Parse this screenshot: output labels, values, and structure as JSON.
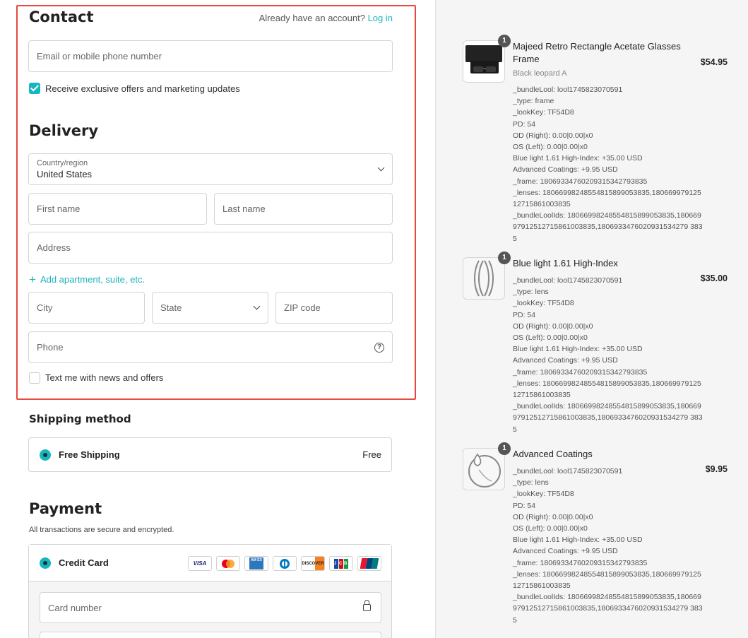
{
  "contact": {
    "title": "Contact",
    "login_prompt": "Already have an account?",
    "login_link": "Log in",
    "email_placeholder": "Email or mobile phone number",
    "marketing_label": "Receive exclusive offers and marketing updates"
  },
  "delivery": {
    "title": "Delivery",
    "country_label": "Country/region",
    "country_value": "United States",
    "first_name_placeholder": "First name",
    "last_name_placeholder": "Last name",
    "address_placeholder": "Address",
    "add_apartment": "Add apartment, suite, etc.",
    "city_placeholder": "City",
    "state_placeholder": "State",
    "zip_placeholder": "ZIP code",
    "phone_placeholder": "Phone",
    "sms_label": "Text me with news and offers"
  },
  "shipping": {
    "title": "Shipping method",
    "option_name": "Free Shipping",
    "option_price": "Free"
  },
  "payment": {
    "title": "Payment",
    "subtitle": "All transactions are secure and encrypted.",
    "method": "Credit Card",
    "card_logos": [
      "VISA",
      "MC",
      "AMEX",
      "DINERS",
      "DISCOVER",
      "JCB",
      "UNIONPAY"
    ],
    "card_number_placeholder": "Card number"
  },
  "colors": {
    "accent": "#1db3bd",
    "highlight_border": "#e8493f"
  },
  "items": [
    {
      "qty": "1",
      "name": "Majeed Retro Rectangle Acetate Glasses Frame",
      "variant": "Black leopard A",
      "price": "$54.95",
      "props": [
        "_bundleLool:  lool1745823070591",
        "_type:  frame",
        "_lookKey:  TF54D8",
        "PD:  54",
        "OD (Right):  0.00|0.00|x0",
        "OS (Left):  0.00|0.00|x0",
        "Blue light 1.61 High-Index:  +35.00 USD",
        "Advanced Coatings:  +9.95 USD",
        "_frame:  18069334760209315342793835",
        "_lenses:  18066998248554815899053835,18066997912512715861003835",
        "_bundleLoolIds:  18066998248554815899053835,18066997912512715861003835,1806933476020931534279 3835"
      ]
    },
    {
      "qty": "1",
      "name": "Blue light 1.61 High-Index",
      "variant": "",
      "price": "$35.00",
      "props": [
        "_bundleLool:  lool1745823070591",
        "_type:  lens",
        "_lookKey:  TF54D8",
        "PD:  54",
        "OD (Right):  0.00|0.00|x0",
        "OS (Left):  0.00|0.00|x0",
        "Blue light 1.61 High-Index:  +35.00 USD",
        "Advanced Coatings:  +9.95 USD",
        "_frame:  18069334760209315342793835",
        "_lenses:  18066998248554815899053835,18066997912512715861003835",
        "_bundleLoolIds:  18066998248554815899053835,18066997912512715861003835,1806933476020931534279 3835"
      ]
    },
    {
      "qty": "1",
      "name": "Advanced Coatings",
      "variant": "",
      "price": "$9.95",
      "props": [
        "_bundleLool:  lool1745823070591",
        "_type:  lens",
        "_lookKey:  TF54D8",
        "PD:  54",
        "OD (Right):  0.00|0.00|x0",
        "OS (Left):  0.00|0.00|x0",
        "Blue light 1.61 High-Index:  +35.00 USD",
        "Advanced Coatings:  +9.95 USD",
        "_frame:  18069334760209315342793835",
        "_lenses:  18066998248554815899053835,18066997912512715861003835",
        "_bundleLoolIds:  18066998248554815899053835,18066997912512715861003835,1806933476020931534279 3835"
      ]
    }
  ]
}
